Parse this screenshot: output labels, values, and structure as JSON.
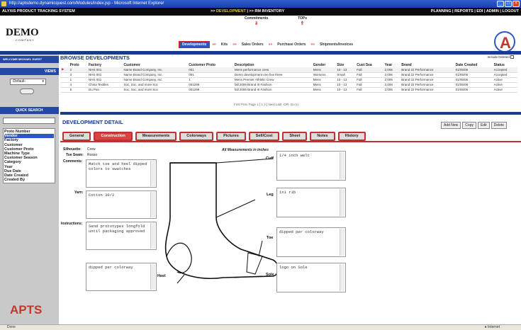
{
  "window": {
    "title": "http://aptsdemo.dynamicquest.com/Modules/index.jsp - Microsoft Internet Explorer"
  },
  "appbar": {
    "left": "ALYXIS PRODUCT TRACKING SYSTEM",
    "center_prefix": ">> ",
    "center_dev": "DEVELOPMENT",
    "center_sep": " | >> ",
    "center_rm": "RM INVENTORY",
    "right": "PLANNING | REPORTS | EDI | ADMIN | LOGOUT"
  },
  "logo": {
    "name": "DEMO",
    "sub": "COMPANY"
  },
  "topnav": {
    "commitments": "Commitments",
    "tops": "TOPs"
  },
  "nav": {
    "tabs": [
      "Developments",
      "Kits",
      "Sales Orders",
      "Purchase Orders",
      "Shipments/Invoices"
    ],
    "active": 0,
    "sep": "»"
  },
  "sidebar": {
    "welcome": "WELCOME MICHAEL GUEST",
    "views_label": "VIEWS",
    "views_select": "-Default-",
    "quick_search": "QUICK SEARCH",
    "search_fields": [
      "Proto Number",
      "Vendor",
      "Factory",
      "Customer",
      "Customer Proto",
      "Machine Type",
      "Customer Season",
      "Category",
      "Year",
      "Due Date",
      "Date Created",
      "Created By"
    ],
    "selected_field": 1,
    "brand": "APTS"
  },
  "browse": {
    "title": "BROWSE DEVELOPMENTS",
    "include_deleted": "Include Deleted",
    "headers": [
      "Proto",
      "Factory",
      "Customer",
      "Customer Proto",
      "Description",
      "Gender",
      "Size",
      "Cust Sea",
      "Year",
      "Brand",
      "Date Created",
      "Status"
    ],
    "rows": [
      [
        "2",
        "NHS 001",
        "Name Brand Company, Inc.",
        "001",
        "Mens performance crew",
        "Mens",
        "10 - 13",
        "Fall",
        "2,006",
        "Brand 22 Performance",
        "01/05/06",
        "Accepted"
      ],
      [
        "3",
        "NHS 001",
        "Name Brand Company, Inc.",
        "001",
        "Demo development one five three",
        "Womens",
        "Small",
        "Fall",
        "2,006",
        "Brand 22 Performance",
        "01/05/06",
        "Accepted"
      ],
      [
        "1",
        "NHS 001",
        "Name Brand Company, Inc.",
        "1",
        "Mens Premier Athletic Crew",
        "Mens",
        "10 - 13",
        "Fall",
        "2,006",
        "Brand 22 Performance",
        "01/05/06",
        "Active"
      ],
      [
        "4",
        "China Textiles",
        "Soc, Soc, and more Soc",
        "001299",
        "fall 2006 Brand III Fashion",
        "Mens",
        "10 - 13",
        "Fall",
        "2,006",
        "Brand 22 Performance",
        "01/05/06",
        "Active"
      ],
      [
        "5",
        "Du Pan",
        "Soc, Soc, and more Soc",
        "001299",
        "fall 2006 Brand III Fashion",
        "Mens",
        "10 - 13",
        "Fall",
        "2,006",
        "Brand 22 Performance",
        "01/05/06",
        "Active"
      ]
    ],
    "pager": "First  Prev  Page 1 [ 1 2 ] Next  Last  -OR-  Go to:"
  },
  "detail": {
    "title": "DEVELOPMENT DETAIL",
    "actions": [
      "Add New",
      "Copy",
      "Edit",
      "Delete"
    ],
    "tabs": [
      "General",
      "Construction",
      "Measurements",
      "Colorways",
      "Pictures",
      "Sell/Cost",
      "Sheet",
      "Notes",
      "History"
    ],
    "active_tab": 1,
    "silhouette_label": "Silhouette:",
    "silhouette": "Crew",
    "toe_seam_label": "Toe Seam:",
    "toe_seam": "Rosso",
    "comments_label": "Comments:",
    "comments": "Match toe and heel dipped colors to swatches",
    "yarn_label": "Yarn:",
    "yarn": "Cotton 30/2",
    "instructions_label": "Instructions:",
    "instructions": "Send prototypes longfold until packaging approved",
    "heel_text": "dipped per colorway",
    "all_measurements": "All Measurements in inches",
    "cuff_label": "Cuff",
    "cuff": "1/4 inch welt",
    "leg_label": "Leg",
    "leg": "1x1 rib",
    "toe_label": "Toe",
    "toe": "dipped per colorway",
    "sole_label": "Sole",
    "sole": "logo on Sole",
    "heel_label": "Heel"
  },
  "status": {
    "left": "Done",
    "right": "Internet"
  }
}
